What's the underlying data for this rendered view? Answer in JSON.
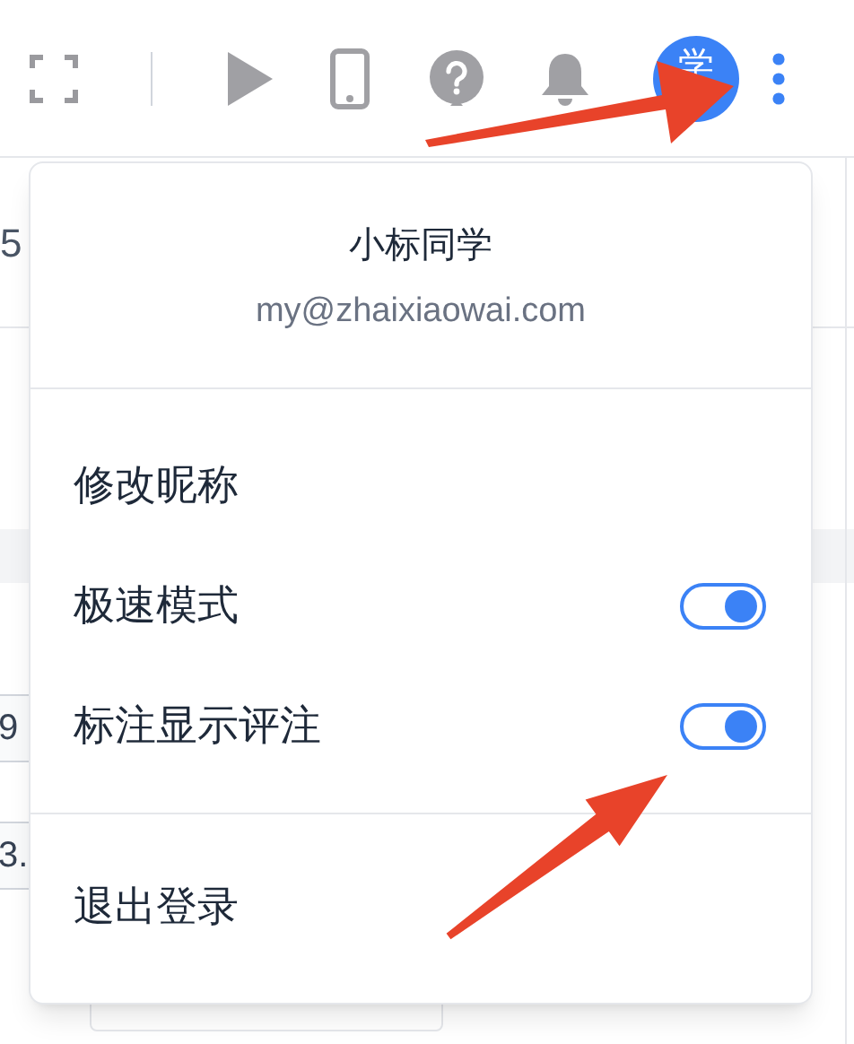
{
  "toolbar": {
    "avatar": {
      "label": "学"
    }
  },
  "background_fragments": [
    {
      "text": "5"
    },
    {
      "text": "9"
    },
    {
      "text": "3."
    }
  ],
  "user_menu": {
    "name": "小标同学",
    "email": "my@zhaixiaowai.com",
    "items": [
      {
        "kind": "action",
        "label": "修改昵称"
      },
      {
        "kind": "toggle",
        "label": "极速模式",
        "on": true
      },
      {
        "kind": "toggle",
        "label": "标注显示评注",
        "on": true
      }
    ],
    "footer_items": [
      {
        "label": "退出登录"
      }
    ]
  }
}
